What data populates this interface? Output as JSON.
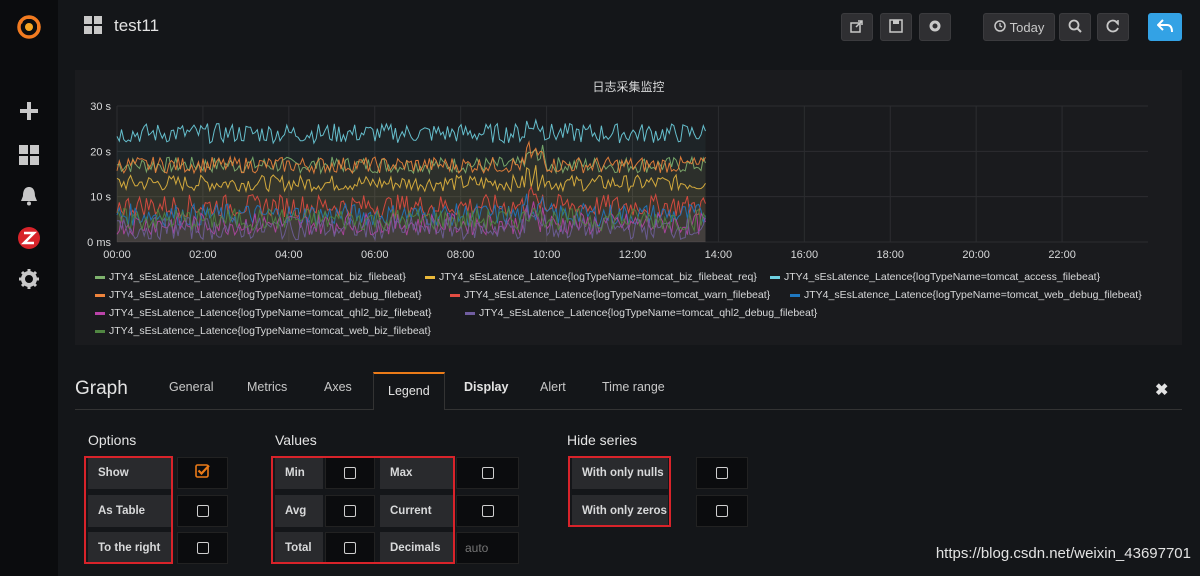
{
  "header": {
    "dashboard_title": "test11",
    "today_label": "Today"
  },
  "panel": {
    "title": "日志采集监控"
  },
  "chart_data": {
    "type": "line",
    "title": "日志采集监控",
    "xlabel": "",
    "ylabel": "",
    "x_ticks": [
      "00:00",
      "02:00",
      "04:00",
      "06:00",
      "08:00",
      "10:00",
      "12:00",
      "14:00",
      "16:00",
      "18:00",
      "20:00",
      "22:00"
    ],
    "y_ticks": [
      "0 ms",
      "10 s",
      "20 s",
      "30 s"
    ],
    "ylim": [
      0,
      30
    ],
    "xlim_hours": [
      0,
      24
    ],
    "data_end_hour": 13.7,
    "grid": true,
    "legend_placement": "bottom",
    "series": [
      {
        "name": "JTY4_sEsLatence_Latence{logTypeName=tomcat_biz_filebeat}",
        "color": "#7eb26d",
        "level": 17
      },
      {
        "name": "JTY4_sEsLatence_Latence{logTypeName=tomcat_biz_filebeat_req}",
        "color": "#eab839",
        "level": 13
      },
      {
        "name": "JTY4_sEsLatence_Latence{logTypeName=tomcat_access_filebeat}",
        "color": "#6ed0e0",
        "level": 24
      },
      {
        "name": "JTY4_sEsLatence_Latence{logTypeName=tomcat_debug_filebeat}",
        "color": "#ef843c",
        "level": 17
      },
      {
        "name": "JTY4_sEsLatence_Latence{logTypeName=tomcat_warn_filebeat}",
        "color": "#e24d42",
        "level": 8
      },
      {
        "name": "JTY4_sEsLatence_Latence{logTypeName=tomcat_web_debug_filebeat}",
        "color": "#1f78c1",
        "level": 6
      },
      {
        "name": "JTY4_sEsLatence_Latence{logTypeName=tomcat_qhl2_biz_filebeat}",
        "color": "#ba43a9",
        "level": 4
      },
      {
        "name": "JTY4_sEsLatence_Latence{logTypeName=tomcat_qhl2_debug_filebeat}",
        "color": "#705da0",
        "level": 3
      },
      {
        "name": "JTY4_sEsLatence_Latence{logTypeName=tomcat_web_biz_filebeat}",
        "color": "#508642",
        "level": 5
      }
    ]
  },
  "editor": {
    "title": "Graph",
    "tabs": [
      "General",
      "Metrics",
      "Axes",
      "Legend",
      "Display",
      "Alert",
      "Time range"
    ],
    "options": {
      "heading": "Options",
      "show": "Show",
      "as_table": "As Table",
      "to_the_right": "To the right"
    },
    "values": {
      "heading": "Values",
      "min": "Min",
      "max": "Max",
      "avg": "Avg",
      "current": "Current",
      "total": "Total",
      "decimals": "Decimals",
      "decimals_placeholder": "auto"
    },
    "hide_series": {
      "heading": "Hide series",
      "with_only_nulls": "With only nulls",
      "with_only_zeros": "With only zeros"
    }
  },
  "watermark": "https://blog.csdn.net/weixin_43697701",
  "colors": {
    "accent": "#eb7b18",
    "highlight": "#d8232a",
    "primary_button": "#33a2e5"
  }
}
